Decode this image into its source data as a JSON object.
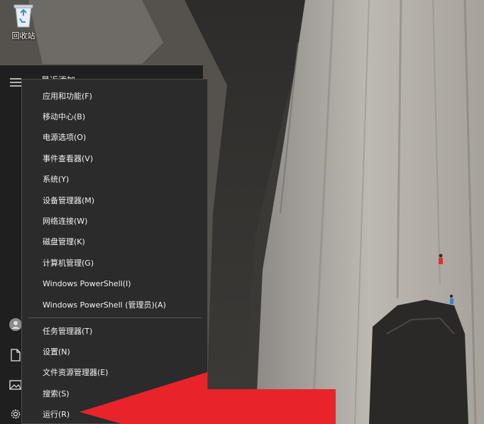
{
  "desktop": {
    "recycle_bin_label": "回收站",
    "recycle_bin_icon": "recycle-bin-icon"
  },
  "start_menu": {
    "recent_label": "最近添加",
    "rail_icons": [
      "hamburger-icon",
      "user-avatar-icon",
      "document-icon",
      "pictures-icon",
      "settings-gear-icon"
    ]
  },
  "context_menu": {
    "group1": [
      "应用和功能(F)",
      "移动中心(B)",
      "电源选项(O)",
      "事件查看器(V)",
      "系统(Y)",
      "设备管理器(M)",
      "网络连接(W)",
      "磁盘管理(K)",
      "计算机管理(G)",
      "Windows PowerShell(I)",
      "Windows PowerShell (管理员)(A)"
    ],
    "group2": [
      "任务管理器(T)",
      "设置(N)",
      "文件资源管理器(E)",
      "搜索(S)",
      "运行(R)"
    ]
  },
  "colors": {
    "menu_bg": "#2b2b2b",
    "start_bg": "#1f1f1f",
    "menu_text": "#f2f2f2",
    "annotation_red": "#e8242a"
  }
}
